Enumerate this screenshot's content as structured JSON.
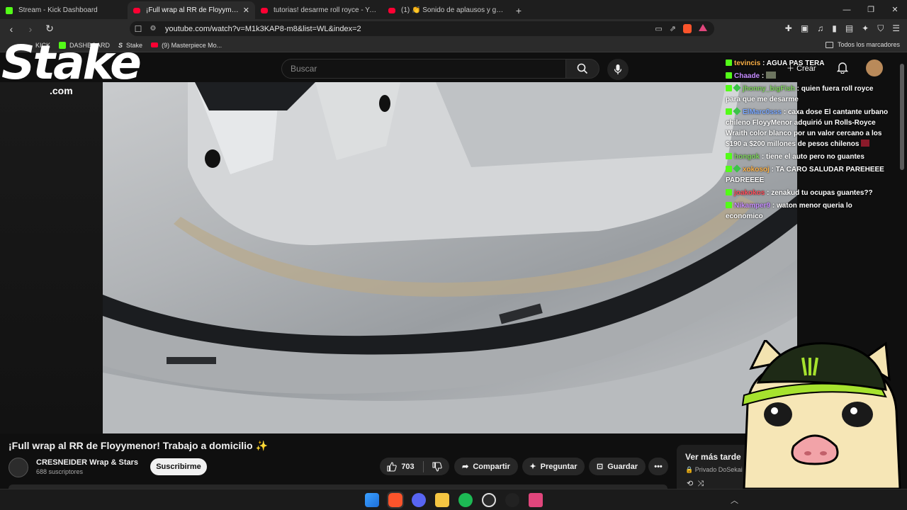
{
  "browser": {
    "tabs": [
      {
        "label": "Stream - Kick Dashboard",
        "icon": "kick-icon",
        "active": false
      },
      {
        "label": "¡Full wrap al RR de Floyymenor!",
        "icon": "youtube-icon",
        "active": true
      },
      {
        "label": "tutorias! desarme roll royce - YouTub",
        "icon": "youtube-icon",
        "active": false
      },
      {
        "label": "(1) 👏 Sonido de aplausos y gritos d",
        "icon": "youtube-icon",
        "active": false
      }
    ],
    "new_tab": "+",
    "url": "youtube.com/watch?v=M1k3KAP8-m8&list=WL&index=2",
    "bookmarks": [
      {
        "label": "KICK",
        "icon": "kick-icon"
      },
      {
        "label": "DASHBOARD",
        "icon": "kick-icon"
      },
      {
        "label": "Stake",
        "icon": "stake-icon"
      },
      {
        "label": "(9) Masterpiece Mo...",
        "icon": "youtube-icon"
      }
    ],
    "all_bookmarks": "Todos los marcadores"
  },
  "youtube": {
    "search_placeholder": "Buscar",
    "create_label": "Crear",
    "video": {
      "title": "¡Full wrap al RR de Floyymenor! Trabajo a domicilio ✨",
      "channel": "CRESNEIDER Wrap & Stars",
      "subscribers": "688 suscriptores",
      "subscribe_label": "Suscribirme",
      "likes": "703",
      "share_label": "Compartir",
      "ask_label": "Preguntar",
      "save_label": "Guardar"
    },
    "watch_later": {
      "title": "Ver más tarde",
      "subtitle": "Privado DoSekai"
    }
  },
  "overlay": {
    "logo_text": "Stake",
    "logo_sub": ".com",
    "chat": [
      {
        "user": "tevincis",
        "text": "AGUA PAS TERA",
        "color": "orange"
      },
      {
        "user": "Chaade",
        "text": "",
        "color": "purple"
      },
      {
        "user": "jhonny_bigFish",
        "text": "quien fuera roll royce para que me desarme",
        "color": "green"
      },
      {
        "user": "ElMarc0sss",
        "text": "caxa dose El cantante urbano chileno FloyyMenor adquirió un Rolls-Royce Wraith color blanco por un valor cercano a los $190 a $200 millones de pesos chilenos",
        "color": "blue"
      },
      {
        "user": "hongok",
        "text": "tiene el auto pero no guantes",
        "color": "green"
      },
      {
        "user": "xokosoj",
        "text": "TA CARO SALUDAR PAREHEEE PADREEEE",
        "color": "orange"
      },
      {
        "user": "joakokos",
        "text": "zenakud tu ocupas guantes??",
        "color": "red"
      },
      {
        "user": "Nikamper9",
        "text": "waton menor queria lo economico",
        "color": "purple"
      }
    ]
  },
  "colors": {
    "kick_green": "#53fc18",
    "youtube_red": "#ff0033",
    "background": "#0f0f0f"
  }
}
